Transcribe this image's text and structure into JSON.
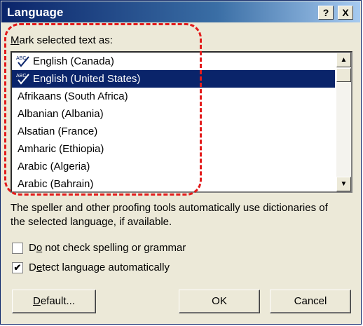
{
  "window": {
    "title": "Language",
    "help_label": "?",
    "close_label": "X"
  },
  "mark_label_prefix": "M",
  "mark_label_rest": "ark selected text as:",
  "languages": [
    {
      "label": "English (Canada)",
      "spell_icon": true,
      "selected": false
    },
    {
      "label": "English (United States)",
      "spell_icon": true,
      "selected": true
    },
    {
      "label": "Afrikaans (South Africa)",
      "spell_icon": false,
      "selected": false
    },
    {
      "label": "Albanian (Albania)",
      "spell_icon": false,
      "selected": false
    },
    {
      "label": "Alsatian (France)",
      "spell_icon": false,
      "selected": false
    },
    {
      "label": "Amharic (Ethiopia)",
      "spell_icon": false,
      "selected": false
    },
    {
      "label": "Arabic (Algeria)",
      "spell_icon": false,
      "selected": false
    },
    {
      "label": "Arabic (Bahrain)",
      "spell_icon": false,
      "selected": false
    }
  ],
  "description": "The speller and other proofing tools automatically use dictionaries of the selected language, if available.",
  "options": {
    "no_check": {
      "prefix": "D",
      "underlined": "o",
      "rest": " not check spelling or grammar",
      "checked": false
    },
    "detect": {
      "prefix": "D",
      "underlined": "e",
      "rest": "tect language automatically",
      "checked": true
    }
  },
  "buttons": {
    "default_u": "D",
    "default_rest": "efault...",
    "ok": "OK",
    "cancel": "Cancel"
  },
  "colors": {
    "selection": "#0a246a",
    "annotation": "#e31b1b"
  }
}
